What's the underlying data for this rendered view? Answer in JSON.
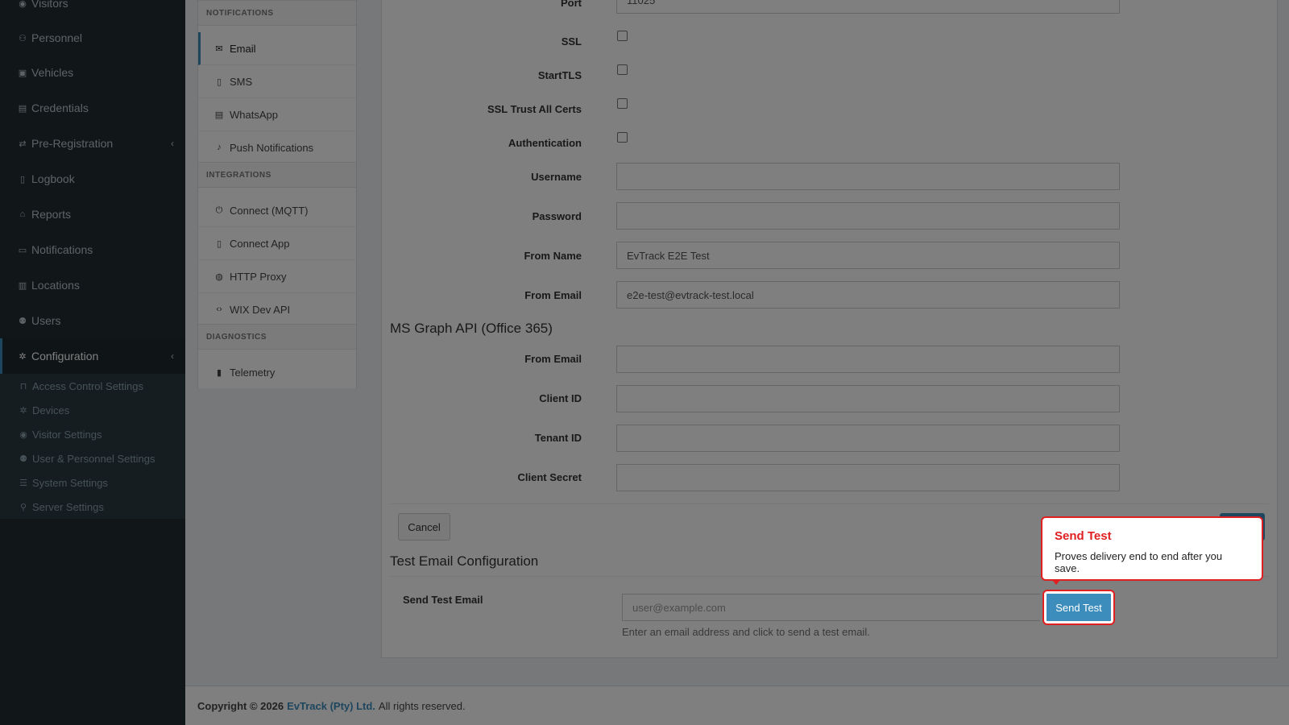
{
  "sidebar": {
    "items": [
      {
        "label": "Visitors",
        "icon": "eye-icon"
      },
      {
        "label": "Personnel",
        "icon": "people-icon"
      },
      {
        "label": "Vehicles",
        "icon": "car-icon"
      },
      {
        "label": "Credentials",
        "icon": "badge-icon"
      },
      {
        "label": "Pre-Registration",
        "icon": "exchange-icon"
      },
      {
        "label": "Logbook",
        "icon": "book-icon"
      },
      {
        "label": "Reports",
        "icon": "chart-icon"
      },
      {
        "label": "Notifications",
        "icon": "chat-icon"
      },
      {
        "label": "Locations",
        "icon": "building-icon"
      },
      {
        "label": "Users",
        "icon": "users-icon"
      },
      {
        "label": "Configuration",
        "icon": "gear-icon"
      }
    ],
    "submenu": [
      {
        "label": "Access Control Settings",
        "icon": "lock-icon"
      },
      {
        "label": "Devices",
        "icon": "gear-icon"
      },
      {
        "label": "Visitor Settings",
        "icon": "eye-icon"
      },
      {
        "label": "User & Personnel Settings",
        "icon": "users-icon"
      },
      {
        "label": "System Settings",
        "icon": "sliders-icon"
      },
      {
        "label": "Server Settings",
        "icon": "server-icon"
      }
    ]
  },
  "subnav": {
    "sections": {
      "notifications": "NOTIFICATIONS",
      "integrations": "INTEGRATIONS",
      "diagnostics": "DIAGNOSTICS"
    },
    "items": [
      {
        "label": "Email",
        "icon": "mail-icon"
      },
      {
        "label": "SMS",
        "icon": "phone-icon"
      },
      {
        "label": "WhatsApp",
        "icon": "message-icon"
      },
      {
        "label": "Push Notifications",
        "icon": "bell-icon"
      },
      {
        "label": "Connect (MQTT)",
        "icon": "plug-icon"
      },
      {
        "label": "Connect App",
        "icon": "mobile-icon"
      },
      {
        "label": "HTTP Proxy",
        "icon": "globe-icon"
      },
      {
        "label": "WIX Dev API",
        "icon": "code-icon"
      },
      {
        "label": "Telemetry",
        "icon": "bar-chart-icon"
      }
    ]
  },
  "form": {
    "port": {
      "label": "Port",
      "value": "11025"
    },
    "ssl": {
      "label": "SSL"
    },
    "starttls": {
      "label": "StartTLS"
    },
    "ssl_trust": {
      "label": "SSL Trust All Certs"
    },
    "auth": {
      "label": "Authentication"
    },
    "username": {
      "label": "Username",
      "value": ""
    },
    "password": {
      "label": "Password",
      "value": ""
    },
    "from_name": {
      "label": "From Name",
      "value": "EvTrack E2E Test"
    },
    "from_email": {
      "label": "From Email",
      "value": "e2e-test@evtrack-test.local"
    }
  },
  "msgraph": {
    "title": "MS Graph API (Office 365)",
    "from_email": {
      "label": "From Email",
      "value": ""
    },
    "client_id": {
      "label": "Client ID",
      "value": ""
    },
    "tenant_id": {
      "label": "Tenant ID",
      "value": ""
    },
    "client_secret": {
      "label": "Client Secret",
      "value": ""
    }
  },
  "actions": {
    "cancel": "Cancel"
  },
  "test": {
    "title": "Test Email Configuration",
    "label": "Send Test Email",
    "placeholder": "user@example.com",
    "button": "Send Test",
    "help": "Enter an email address and click to send a test email."
  },
  "tooltip": {
    "title": "Send Test",
    "body": "Proves delivery end to end after you save."
  },
  "footer": {
    "copyright": "Copyright © 2026",
    "company": "EvTrack (Pty) Ltd.",
    "rights": "All rights reserved."
  },
  "colors": {
    "accent": "#3c8dbc",
    "sidebar": "#222d32",
    "highlight": "#e02020"
  }
}
